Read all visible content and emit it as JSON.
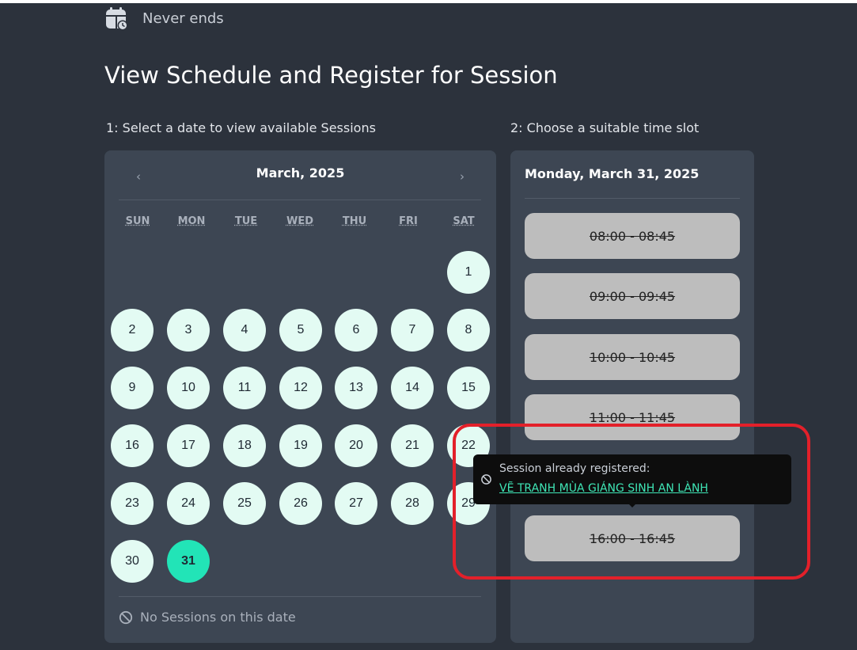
{
  "header": {
    "repeat_text": "Never ends",
    "repeat_icon": "calendar-repeat-icon"
  },
  "page_title": "View Schedule and Register for Session",
  "steps": {
    "step1": "1: Select a date to view available Sessions",
    "step2": "2: Choose a suitable time slot"
  },
  "calendar": {
    "prev": "‹",
    "next": "›",
    "month_label": "March, 2025",
    "weekdays": [
      "SUN",
      "MON",
      "TUE",
      "WED",
      "THU",
      "FRI",
      "SAT"
    ],
    "days": [
      "1",
      "2",
      "3",
      "4",
      "5",
      "6",
      "7",
      "8",
      "9",
      "10",
      "11",
      "12",
      "13",
      "14",
      "15",
      "16",
      "17",
      "18",
      "19",
      "20",
      "21",
      "22",
      "23",
      "24",
      "25",
      "26",
      "27",
      "28",
      "29",
      "30",
      "31"
    ],
    "selected_day": "31",
    "no_sessions_text": "No Sessions on this date"
  },
  "slots_panel": {
    "date_label": "Monday, March 31, 2025",
    "slots": [
      "08:00 - 08:45",
      "09:00 - 09:45",
      "10:00 - 10:45",
      "11:00 - 11:45",
      "16:00 - 16:45"
    ]
  },
  "tooltip": {
    "label": "Session already registered:",
    "link": "VẼ TRANH MÙA GIÁNG SINH AN LÀNH"
  },
  "colors": {
    "background": "#2c323c",
    "panel": "#3d4653",
    "day_bg": "#e3fbf3",
    "selected_day": "#22e4b7",
    "slot_bg": "#bdbdbd",
    "tooltip_link": "#3fe6b6",
    "highlight": "#e3202a"
  }
}
